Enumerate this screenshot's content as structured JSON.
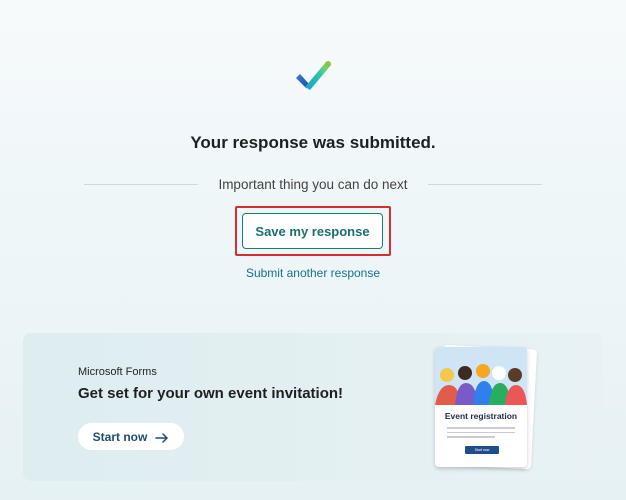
{
  "confirmation": {
    "icon": "checkmark-icon",
    "title": "Your response was submitted.",
    "next_step_label": "Important thing you can do next",
    "save_button_label": "Save my response",
    "submit_another_label": "Submit another response"
  },
  "promo": {
    "brand": "Microsoft Forms",
    "heading": "Get set for your own event invitation!",
    "start_button_label": "Start now",
    "start_button_icon": "arrow-right-icon",
    "card": {
      "title": "Event registration",
      "button_label": "Start now"
    }
  },
  "colors": {
    "accent": "#1b6f70",
    "highlight": "#d32f2f",
    "link": "#1b6f8a"
  }
}
